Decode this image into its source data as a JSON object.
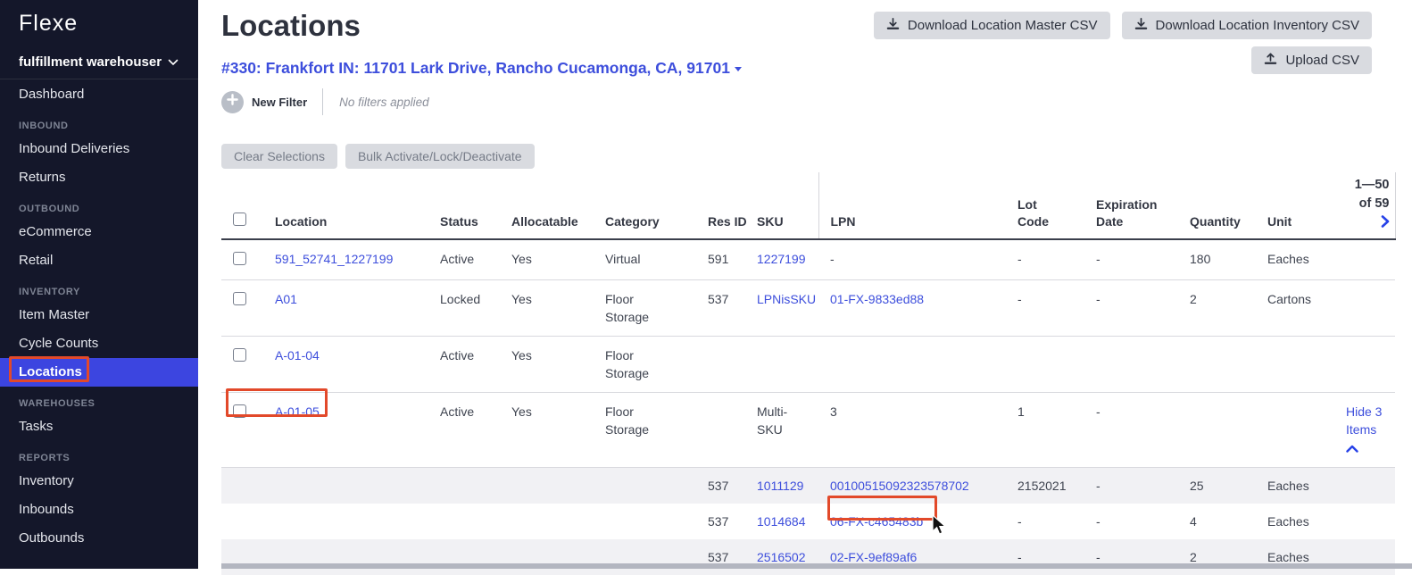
{
  "colors": {
    "accent_blue": "#3c45e0",
    "link_blue": "#3d4edc",
    "annotation": "#e2492a",
    "sidebar_bg": "#14172a"
  },
  "sidebar": {
    "logo": "Flexe",
    "account": "fulfillment warehouser",
    "dashboard": "Dashboard",
    "sections": [
      {
        "title": "INBOUND",
        "items": [
          "Inbound Deliveries",
          "Returns"
        ]
      },
      {
        "title": "OUTBOUND",
        "items": [
          "eCommerce",
          "Retail"
        ]
      },
      {
        "title": "INVENTORY",
        "items": [
          "Item Master",
          "Cycle Counts",
          "Locations"
        ]
      },
      {
        "title": "WAREHOUSES",
        "items": [
          "Tasks"
        ]
      },
      {
        "title": "REPORTS",
        "items": [
          "Inventory",
          "Inbounds",
          "Outbounds"
        ]
      }
    ],
    "active_item": "Locations"
  },
  "header": {
    "title": "Locations",
    "warehouse_link": "#330: Frankfort IN: 11701 Lark Drive, Rancho Cucamonga, CA, 91701",
    "download_master": "Download Location Master CSV",
    "download_inventory": "Download Location Inventory CSV",
    "upload": "Upload CSV"
  },
  "filter_bar": {
    "new_filter": "New Filter",
    "status": "No filters applied"
  },
  "bulk_bar": {
    "clear": "Clear Selections",
    "bulk": "Bulk Activate/Lock/Deactivate"
  },
  "table": {
    "columns": {
      "location": "Location",
      "status": "Status",
      "allocatable": "Allocatable",
      "category": "Category",
      "res_id": "Res ID",
      "sku": "SKU",
      "lpn": "LPN",
      "lot_code": "Lot Code",
      "expiration_date": "Expiration Date",
      "quantity": "Quantity",
      "unit": "Unit"
    },
    "pagination": {
      "range": "1—50",
      "of_total": "of 59"
    },
    "hide_items_label": "Hide 3 Items",
    "rows": [
      {
        "location": "591_52741_1227199",
        "status": "Active",
        "allocatable": "Yes",
        "category": "Virtual",
        "res_id": "591",
        "sku": "1227199",
        "lpn": "-",
        "lot_code": "-",
        "expiration_date": "-",
        "quantity": "180",
        "unit": "Eaches"
      },
      {
        "location": "A01",
        "status": "Locked",
        "allocatable": "Yes",
        "category": "Floor Storage",
        "res_id": "537",
        "sku": "LPNisSKU",
        "lpn": "01-FX-9833ed88",
        "lot_code": "-",
        "expiration_date": "-",
        "quantity": "2",
        "unit": "Cartons"
      },
      {
        "location": "A-01-04",
        "status": "Active",
        "allocatable": "Yes",
        "category": "Floor Storage",
        "res_id": "",
        "sku": "",
        "lpn": "",
        "lot_code": "",
        "expiration_date": "",
        "quantity": "",
        "unit": ""
      },
      {
        "location": "A-01-05",
        "status": "Active",
        "allocatable": "Yes",
        "category": "Floor Storage",
        "res_id": "",
        "sku": "Multi-SKU",
        "lpn": "3",
        "lot_code": "1",
        "expiration_date": "-",
        "quantity": "",
        "unit": ""
      }
    ],
    "subrows": [
      {
        "res_id": "537",
        "sku": "1011129",
        "lpn": "00100515092323578702",
        "lot_code": "2152021",
        "expiration_date": "-",
        "quantity": "25",
        "unit": "Eaches"
      },
      {
        "res_id": "537",
        "sku": "1014684",
        "lpn": "06-FX-c465483b",
        "lot_code": "-",
        "expiration_date": "-",
        "quantity": "4",
        "unit": "Eaches"
      },
      {
        "res_id": "537",
        "sku": "2516502",
        "lpn": "02-FX-9ef89af6",
        "lot_code": "-",
        "expiration_date": "-",
        "quantity": "2",
        "unit": "Eaches"
      }
    ]
  }
}
